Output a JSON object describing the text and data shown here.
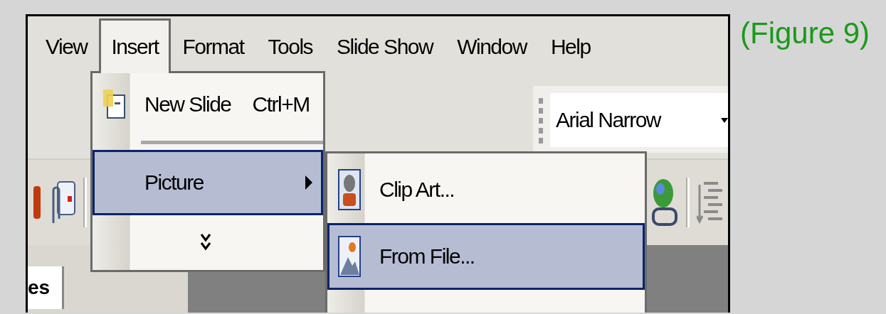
{
  "menu_bar": [
    {
      "label": "View",
      "selected": false
    },
    {
      "label": "Insert",
      "selected": true
    },
    {
      "label": "Format",
      "selected": false
    },
    {
      "label": "Tools",
      "selected": false
    },
    {
      "label": "Slide Show",
      "selected": false
    },
    {
      "label": "Window",
      "selected": false
    },
    {
      "label": "Help",
      "selected": false
    }
  ],
  "insert_menu": {
    "items": [
      {
        "kind": "command",
        "label": "New Slide",
        "shortcut": "Ctrl+M",
        "selected": false
      },
      {
        "kind": "submenu",
        "label": "Picture",
        "selected": true
      },
      {
        "kind": "expand",
        "selected": false
      }
    ]
  },
  "picture_submenu": {
    "items": [
      {
        "kind": "clipart",
        "label": "Clip Art...",
        "selected": false
      },
      {
        "kind": "file",
        "label": "From File...",
        "selected": true
      }
    ]
  },
  "font_box": {
    "value": "Arial Narrow"
  },
  "panel_tab": {
    "label": "es"
  },
  "caption": "(Figure 9)"
}
